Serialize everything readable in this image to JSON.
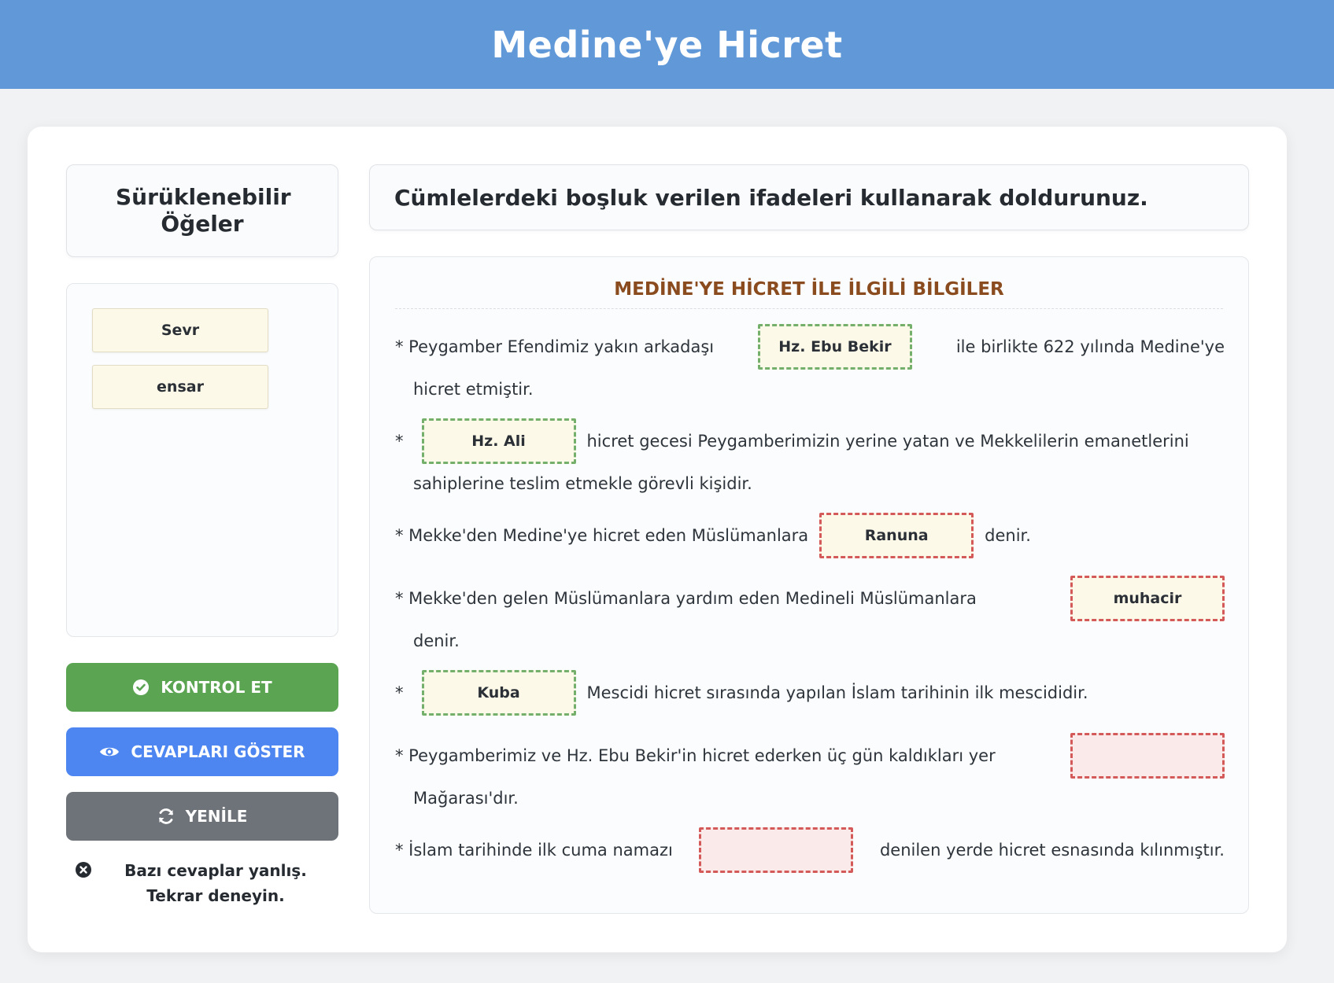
{
  "header": {
    "title": "Medine'ye Hicret"
  },
  "left_panel": {
    "title": "Sürüklenebilir Öğeler",
    "items": [
      {
        "label": "Sevr"
      },
      {
        "label": "ensar"
      }
    ],
    "buttons": {
      "check": "KONTROL ET",
      "show_answers": "CEVAPLARI GÖSTER",
      "reset": "YENİLE"
    },
    "status_message": "Bazı cevaplar yanlış. Tekrar deneyin."
  },
  "instruction": "Cümlelerdeki boşluk verilen ifadeleri kullanarak doldurunuz.",
  "section_title": "MEDİNE'YE HİCRET İLE İLGİLİ BİLGİLER",
  "sentences": [
    {
      "before": "* Peygamber Efendimiz yakın arkadaşı",
      "answer": "Hz. Ebu Bekir",
      "after": "ile birlikte 622 yılında Medine'ye",
      "cont": "hicret etmiştir.",
      "state": "correct"
    },
    {
      "before": "*",
      "answer": "Hz. Ali",
      "after": "hicret gecesi Peygamberimizin yerine yatan ve Mekkelilerin emanetlerini",
      "cont": "sahiplerine teslim etmekle görevli kişidir.",
      "state": "correct"
    },
    {
      "before": "* Mekke'den Medine'ye hicret eden Müslümanlara",
      "answer": "Ranuna",
      "after": "denir.",
      "cont": "",
      "state": "wrong"
    },
    {
      "before": "* Mekke'den gelen Müslümanlara yardım eden Medineli Müslümanlara",
      "answer": "muhacir",
      "after": "",
      "cont": "denir.",
      "state": "wrong"
    },
    {
      "before": "*",
      "answer": "Kuba",
      "after": "Mescidi hicret sırasında yapılan İslam tarihinin ilk mescididir.",
      "cont": "",
      "state": "correct"
    },
    {
      "before": "* Peygamberimiz ve Hz. Ebu Bekir'in hicret ederken üç gün kaldıkları yer",
      "answer": "",
      "after": "",
      "cont": "Mağarası'dır.",
      "state": "empty"
    },
    {
      "before": "* İslam tarihinde ilk cuma namazı",
      "answer": "",
      "after": "denilen yerde hicret esnasında kılınmıştır.",
      "cont": "",
      "state": "empty"
    }
  ],
  "colors": {
    "header_bg": "#6199d8",
    "correct_border": "#74b06c",
    "wrong_border": "#d45a5a",
    "section_title": "#8a4b1f",
    "check_button": "#5ba552",
    "show_button": "#4d86f0",
    "reset_button": "#6e7379"
  },
  "icons": {
    "check": "check-circle-icon",
    "show": "eye-icon",
    "reset": "refresh-icon",
    "status": "x-circle-icon"
  }
}
